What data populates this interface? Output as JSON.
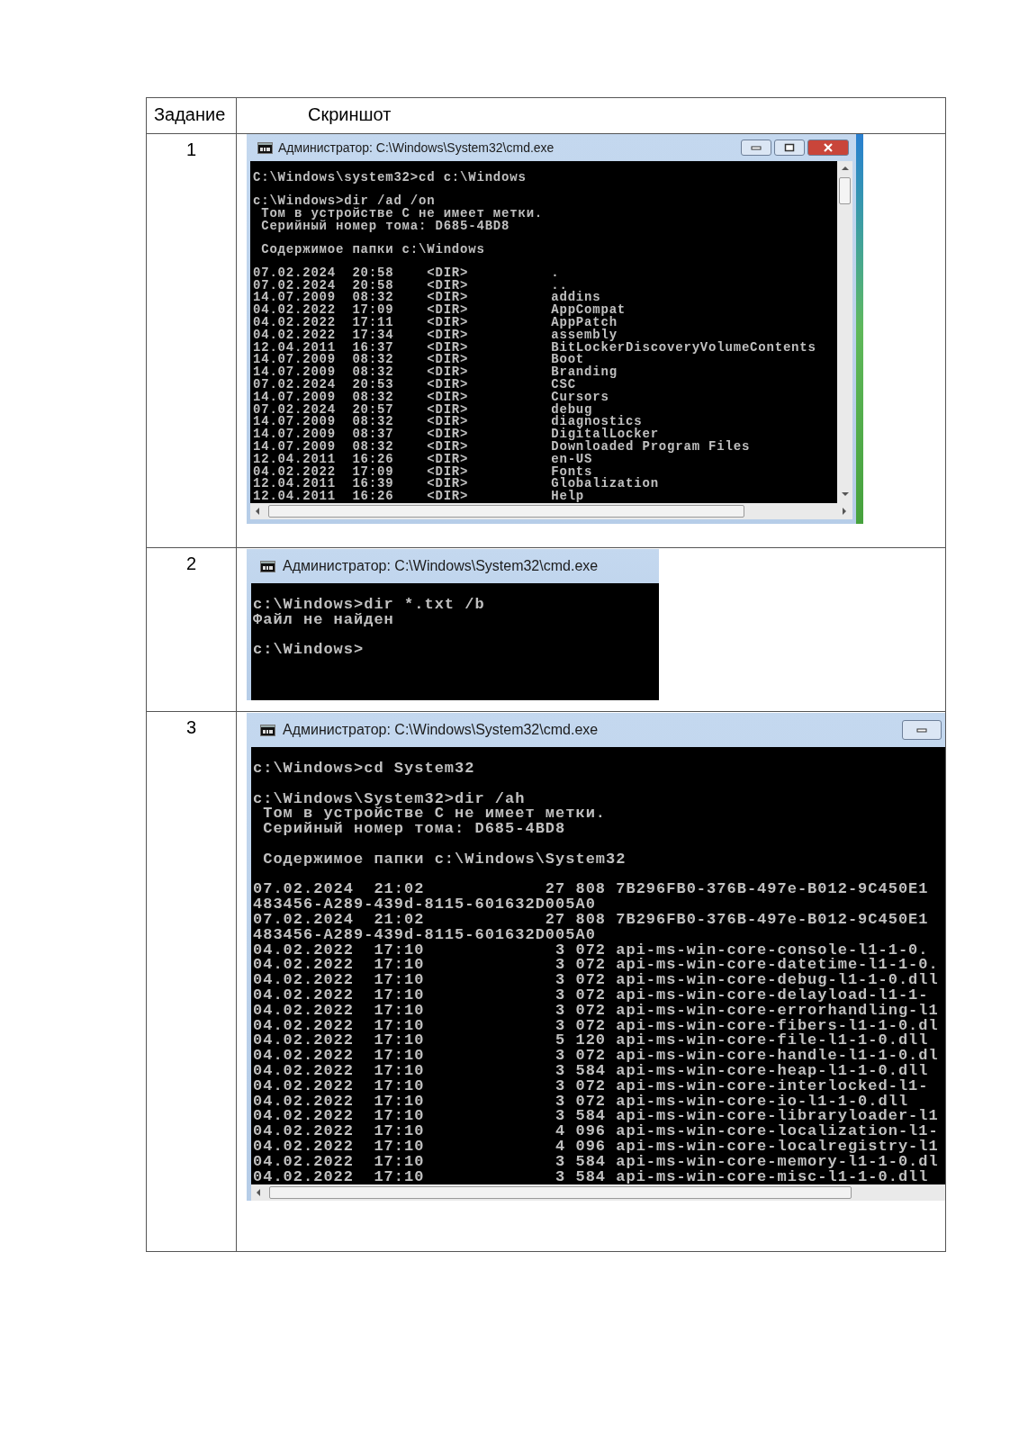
{
  "table": {
    "columns": [
      "Задание",
      "Скриншот"
    ],
    "rows": [
      {
        "task": "1",
        "window": {
          "kind": "compact",
          "title": "Администратор: C:\\Windows\\System32\\cmd.exe",
          "controls": [
            {
              "kind": "minimize"
            },
            {
              "kind": "maximize"
            },
            {
              "kind": "close"
            }
          ],
          "scrollbars": {
            "vertical": true,
            "horizontal": true
          },
          "desktop_edge": true,
          "blocks": [
            [
              "C:\\Windows\\system32>cd c:\\Windows"
            ],
            [
              "c:\\Windows>dir /ad /on",
              " Том в устройстве C не имеет метки.",
              " Серийный номер тома: D685-4BD8"
            ],
            [
              " Содержимое папки c:\\Windows"
            ],
            [
              "07.02.2024  20:58    <DIR>          .",
              "07.02.2024  20:58    <DIR>          ..",
              "14.07.2009  08:32    <DIR>          addins",
              "04.02.2022  17:09    <DIR>          AppCompat",
              "04.02.2022  17:11    <DIR>          AppPatch",
              "04.02.2022  17:34    <DIR>          assembly",
              "12.04.2011  16:37    <DIR>          BitLockerDiscoveryVolumeContents",
              "14.07.2009  08:32    <DIR>          Boot",
              "14.07.2009  08:32    <DIR>          Branding",
              "07.02.2024  20:53    <DIR>          CSC",
              "14.07.2009  08:32    <DIR>          Cursors",
              "07.02.2024  20:57    <DIR>          debug",
              "14.07.2009  08:32    <DIR>          diagnostics",
              "14.07.2009  08:37    <DIR>          DigitalLocker",
              "14.07.2009  08:32    <DIR>          Downloaded Program Files",
              "12.04.2011  16:26    <DIR>          en-US",
              "04.02.2022  17:09    <DIR>          Fonts",
              "12.04.2011  16:39    <DIR>          Globalization",
              "12.04.2011  16:26    <DIR>          Help"
            ]
          ]
        }
      },
      {
        "task": "2",
        "window": {
          "kind": "zoomed",
          "title": "Администратор: C:\\Windows\\System32\\cmd.exe",
          "scrollbars": {
            "vertical": false,
            "horizontal": false
          },
          "desktop_edge": false,
          "blocks": [
            [
              "c:\\Windows>dir *.txt /b",
              "Файл не найден"
            ],
            [
              "c:\\Windows>"
            ]
          ]
        }
      },
      {
        "task": "3",
        "window": {
          "kind": "zoomed",
          "title": "Администратор: C:\\Windows\\System32\\cmd.exe",
          "controls": [
            {
              "kind": "minimize"
            }
          ],
          "scrollbars": {
            "vertical": false,
            "horizontal": true
          },
          "desktop_edge": false,
          "blocks": [
            [
              "c:\\Windows>cd System32"
            ],
            [
              "c:\\Windows\\System32>dir /ah",
              " Том в устройстве C не имеет метки.",
              " Серийный номер тома: D685-4BD8"
            ],
            [
              " Содержимое папки c:\\Windows\\System32"
            ],
            [
              "07.02.2024  21:02            27 808 7B296FB0-376B-497e-B012-9C450E1",
              "483456-A289-439d-8115-601632D005A0",
              "07.02.2024  21:02            27 808 7B296FB0-376B-497e-B012-9C450E1",
              "483456-A289-439d-8115-601632D005A0",
              "04.02.2022  17:10             3 072 api-ms-win-core-console-l1-1-0.",
              "04.02.2022  17:10             3 072 api-ms-win-core-datetime-l1-1-0.",
              "04.02.2022  17:10             3 072 api-ms-win-core-debug-l1-1-0.dll",
              "04.02.2022  17:10             3 072 api-ms-win-core-delayload-l1-1-",
              "04.02.2022  17:10             3 072 api-ms-win-core-errorhandling-l1",
              "04.02.2022  17:10             3 072 api-ms-win-core-fibers-l1-1-0.dl",
              "04.02.2022  17:10             5 120 api-ms-win-core-file-l1-1-0.dll",
              "04.02.2022  17:10             3 072 api-ms-win-core-handle-l1-1-0.dl",
              "04.02.2022  17:10             3 584 api-ms-win-core-heap-l1-1-0.dll",
              "04.02.2022  17:10             3 072 api-ms-win-core-interlocked-l1-",
              "04.02.2022  17:10             3 072 api-ms-win-core-io-l1-1-0.dll",
              "04.02.2022  17:10             3 584 api-ms-win-core-libraryloader-l1",
              "04.02.2022  17:10             4 096 api-ms-win-core-localization-l1-",
              "04.02.2022  17:10             4 096 api-ms-win-core-localregistry-l1",
              "04.02.2022  17:10             3 584 api-ms-win-core-memory-l1-1-0.dl",
              "04.02.2022  17:10             3 584 api-ms-win-core-misc-l1-1-0.dll"
            ]
          ]
        }
      }
    ]
  }
}
